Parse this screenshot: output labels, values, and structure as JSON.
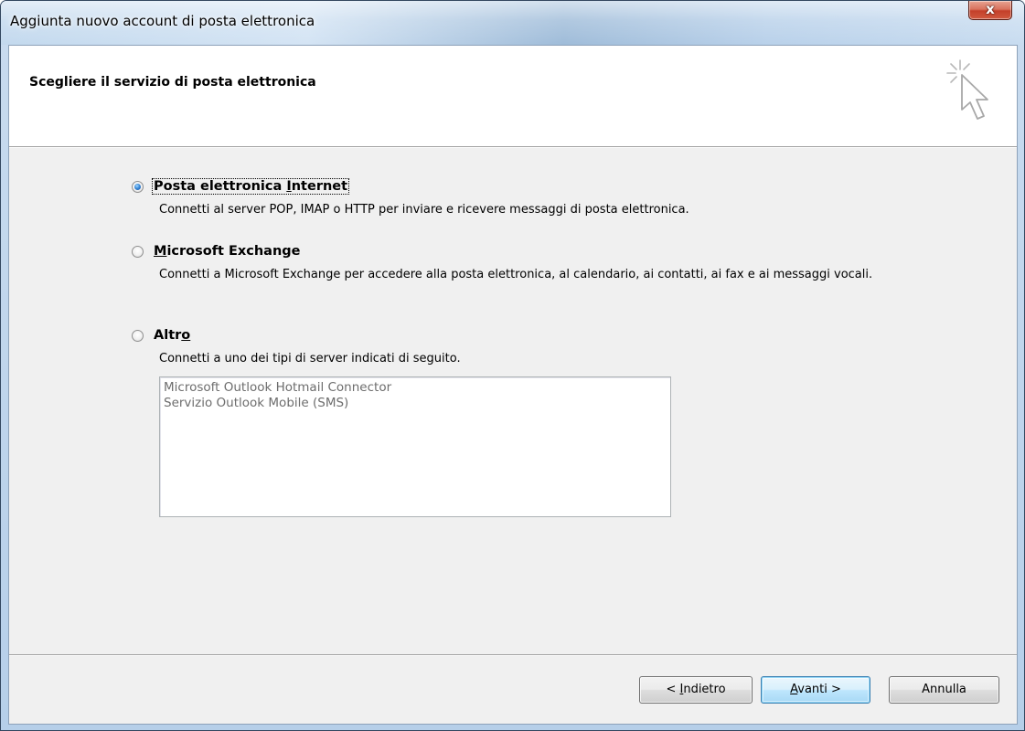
{
  "window": {
    "title": "Aggiunta nuovo account di posta elettronica",
    "close_glyph": "x"
  },
  "header": {
    "title": "Scegliere il servizio di posta elettronica",
    "icon": "wizard-cursor-sparkle-icon"
  },
  "options": [
    {
      "label": "Posta elettronica Internet",
      "description": "Connetti al server POP, IMAP o HTTP per inviare e ricevere messaggi di posta elettronica.",
      "selected": true
    },
    {
      "label": "Microsoft Exchange",
      "description": "Connetti a Microsoft Exchange per accedere alla posta elettronica, al calendario, ai contatti, ai fax e ai messaggi vocali.",
      "selected": false
    },
    {
      "label": "Altro",
      "description": "Connetti a uno dei tipi di server indicati di seguito.",
      "selected": false
    }
  ],
  "server_list": {
    "items": [
      "Microsoft Outlook Hotmail Connector",
      "Servizio Outlook Mobile (SMS)"
    ],
    "enabled": false
  },
  "buttons": {
    "back_prefix": "< ",
    "back_hotkey": "I",
    "back_rest": "ndietro",
    "next_hotkey": "A",
    "next_rest": "vanti >",
    "cancel": "Annulla"
  },
  "colors": {
    "default_button_border": "#3c7fb1",
    "radio_dot": "#1f63b8",
    "disabled_text": "#6d6d6d"
  }
}
